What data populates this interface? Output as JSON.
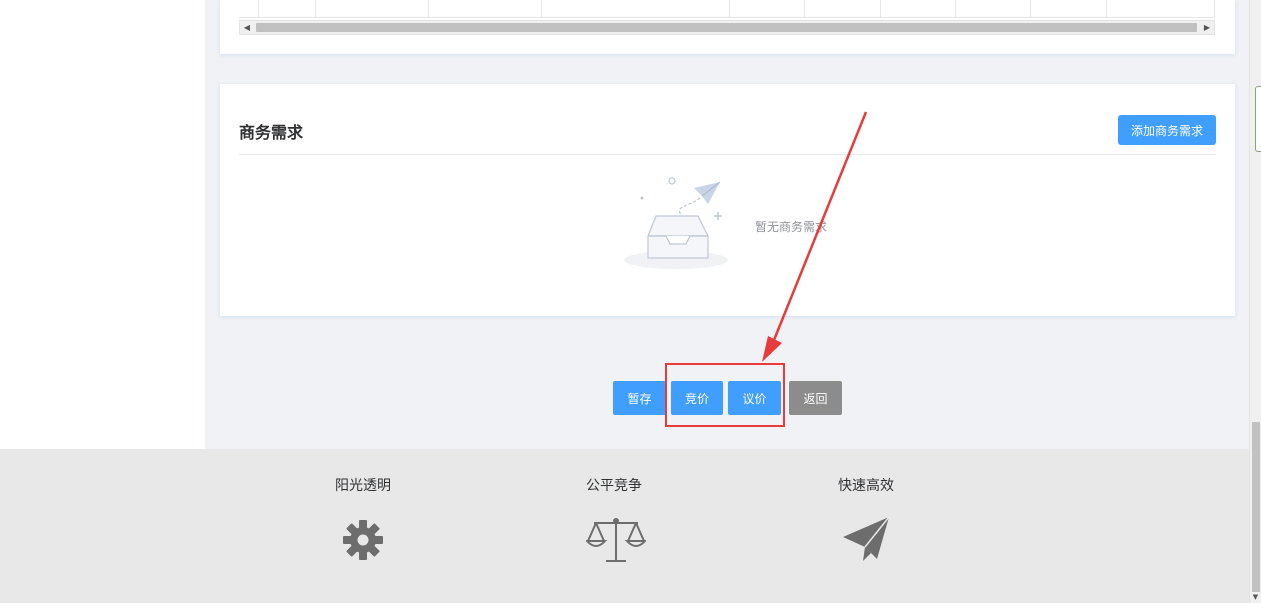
{
  "requirements": {
    "title": "商务需求",
    "add_button_label": "添加商务需求",
    "empty_text": "暂无商务需求"
  },
  "actions": {
    "save_draft": "暂存",
    "bidding": "竞价",
    "negotiation": "议价",
    "back": "返回"
  },
  "footer": {
    "features": [
      {
        "label": "阳光透明",
        "icon": "gear-icon"
      },
      {
        "label": "公平竞争",
        "icon": "scales-icon"
      },
      {
        "label": "快速高效",
        "icon": "paper-plane-icon"
      }
    ]
  },
  "colors": {
    "primary": "#409eff",
    "back_button": "#8c8c8c",
    "annotation": "#e83b3b",
    "footer_bg": "#e8e8e8",
    "page_bg": "#f0f2f5"
  }
}
